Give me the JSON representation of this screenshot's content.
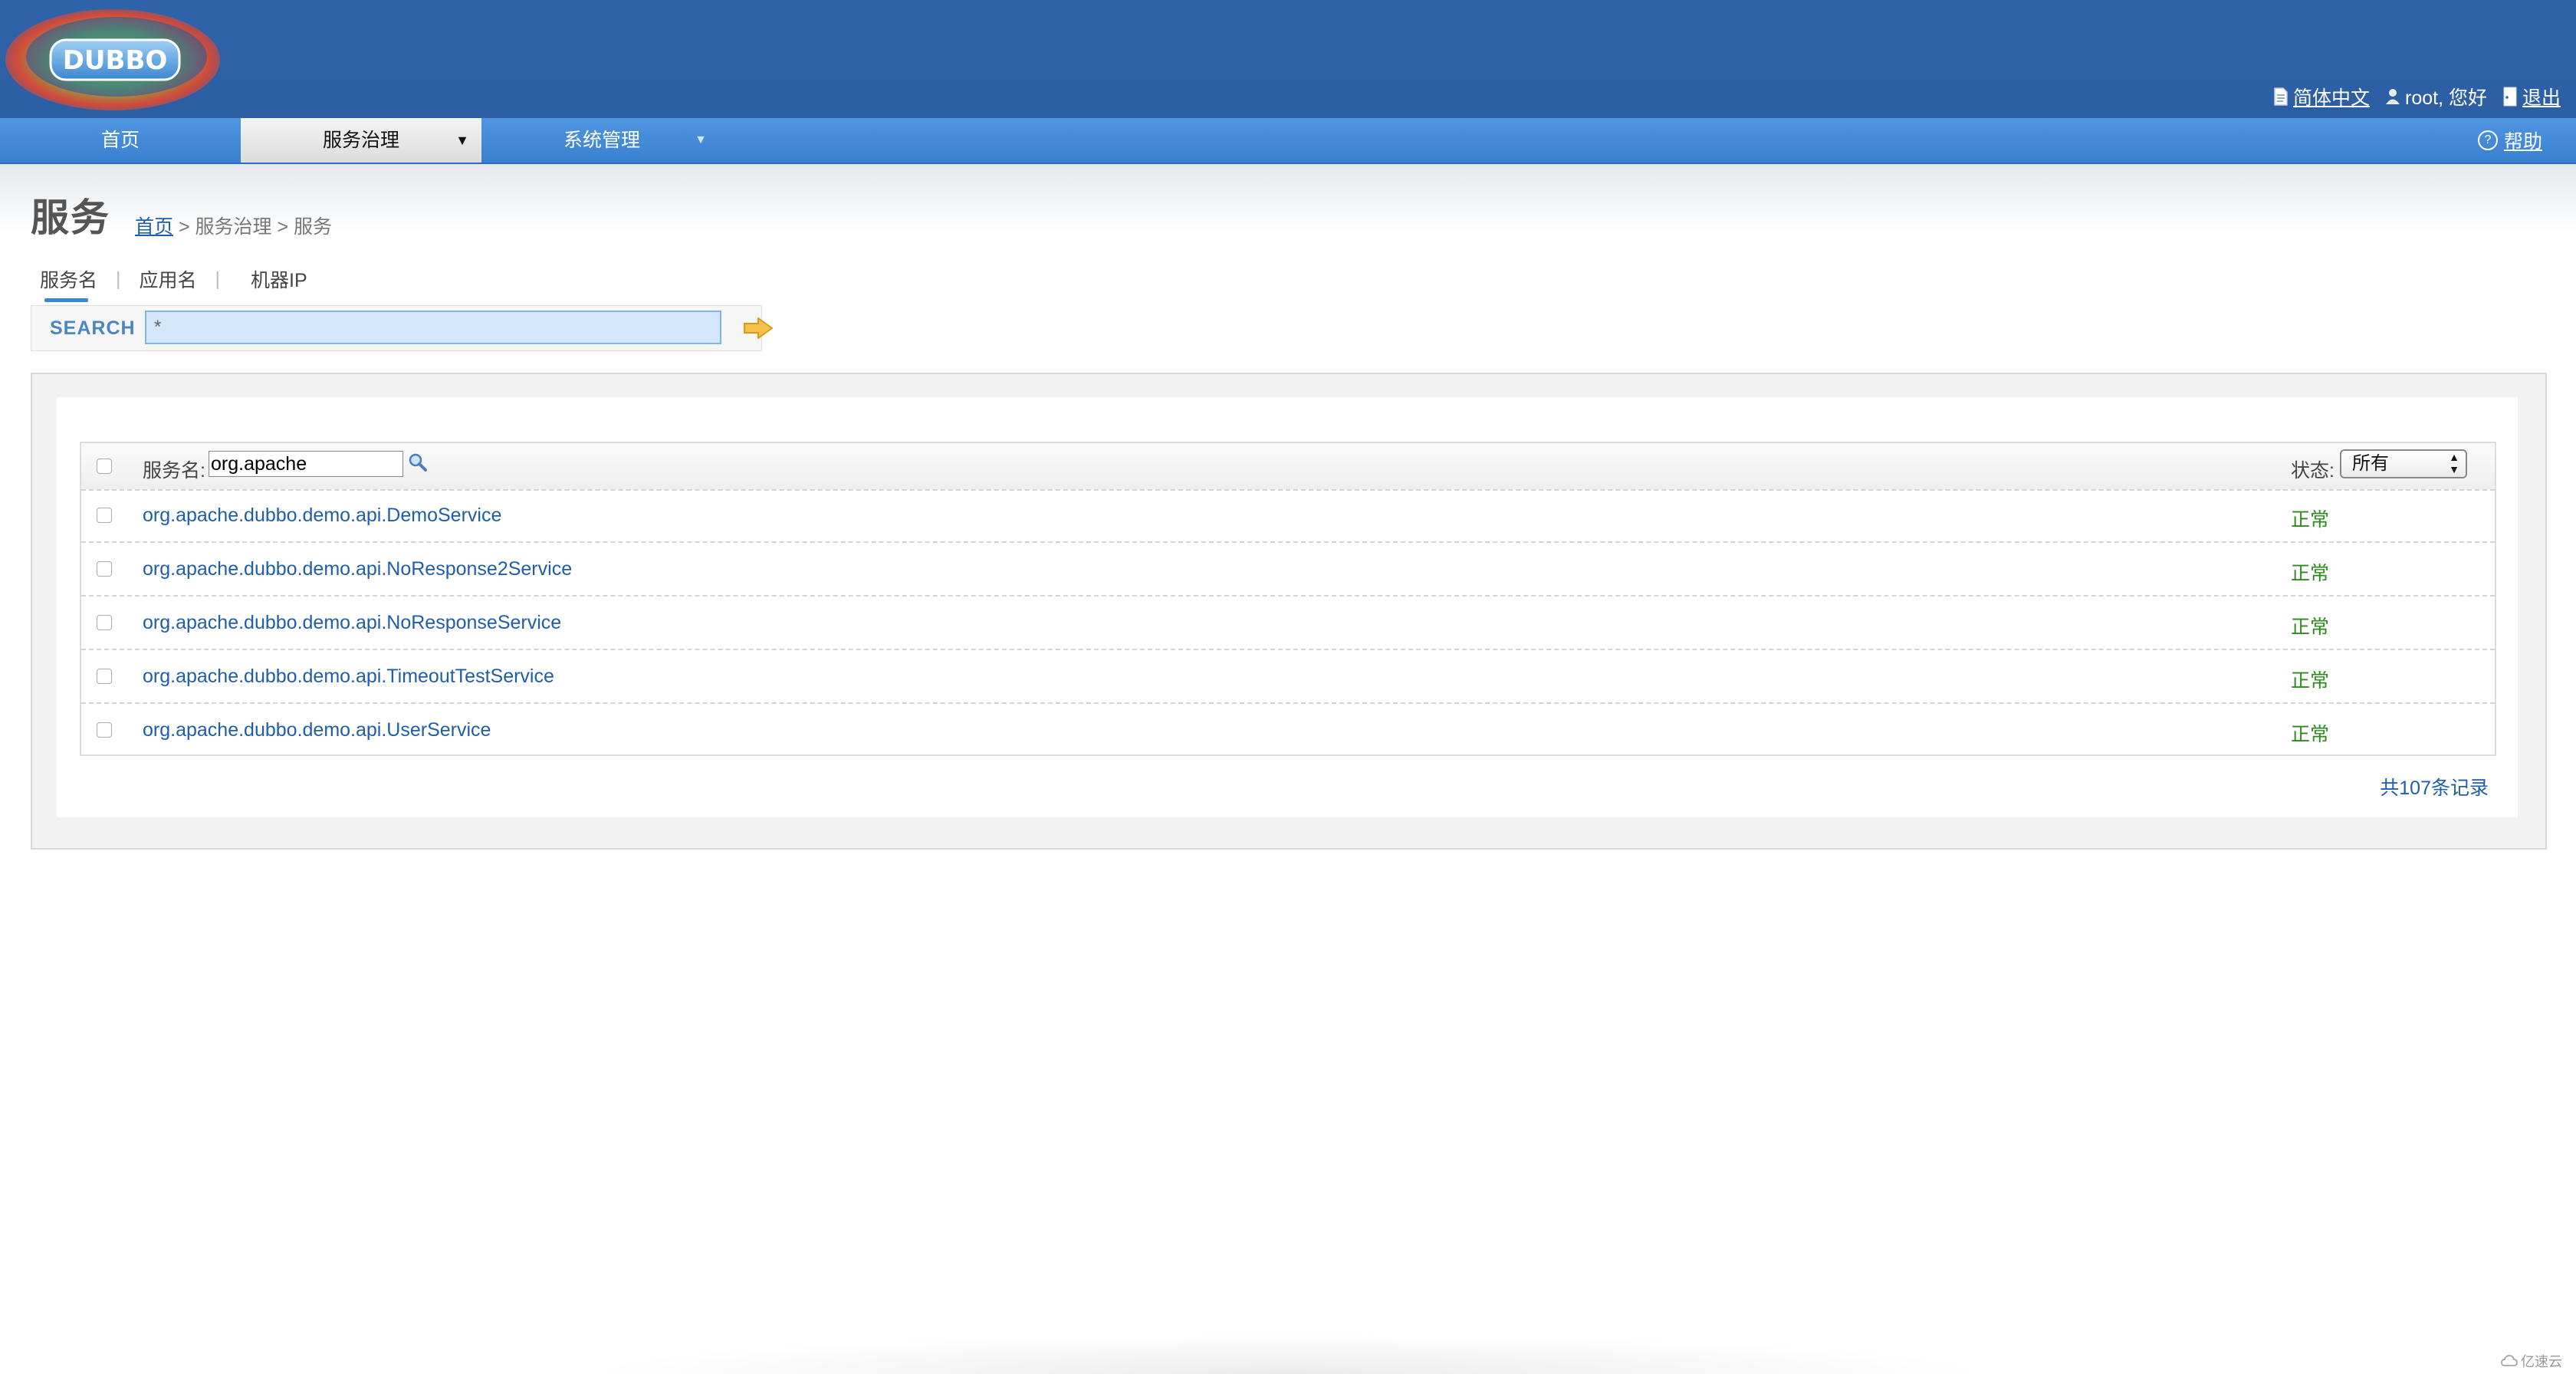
{
  "header": {
    "logo_text": "DUBBO",
    "language_label": "简体中文",
    "user_greeting": "root, 您好",
    "logout_label": "退出"
  },
  "nav": {
    "items": [
      {
        "label": "首页"
      },
      {
        "label": "服务治理"
      },
      {
        "label": "系统管理"
      }
    ],
    "help_label": "帮助"
  },
  "page": {
    "title": "服务",
    "breadcrumb": {
      "home": "首页",
      "rest": "> 服务治理 > 服务"
    }
  },
  "filter_tabs": [
    "服务名",
    "应用名",
    "机器IP"
  ],
  "search": {
    "label": "SEARCH",
    "value": "*"
  },
  "table": {
    "filter_label": "服务名:",
    "filter_value": "org.apache",
    "status_label": "状态:",
    "status_selected": "所有",
    "rows": [
      {
        "name": "org.apache.dubbo.demo.api.DemoService",
        "status": "正常"
      },
      {
        "name": "org.apache.dubbo.demo.api.NoResponse2Service",
        "status": "正常"
      },
      {
        "name": "org.apache.dubbo.demo.api.NoResponseService",
        "status": "正常"
      },
      {
        "name": "org.apache.dubbo.demo.api.TimeoutTestService",
        "status": "正常"
      },
      {
        "name": "org.apache.dubbo.demo.api.UserService",
        "status": "正常"
      }
    ],
    "total_label": "共107条记录"
  },
  "watermark": "亿速云",
  "colors": {
    "header_blue": "#2f62a8",
    "nav_blue": "#3a80d0",
    "link_blue": "#1f5ea8",
    "status_green": "#2f8a1e"
  }
}
